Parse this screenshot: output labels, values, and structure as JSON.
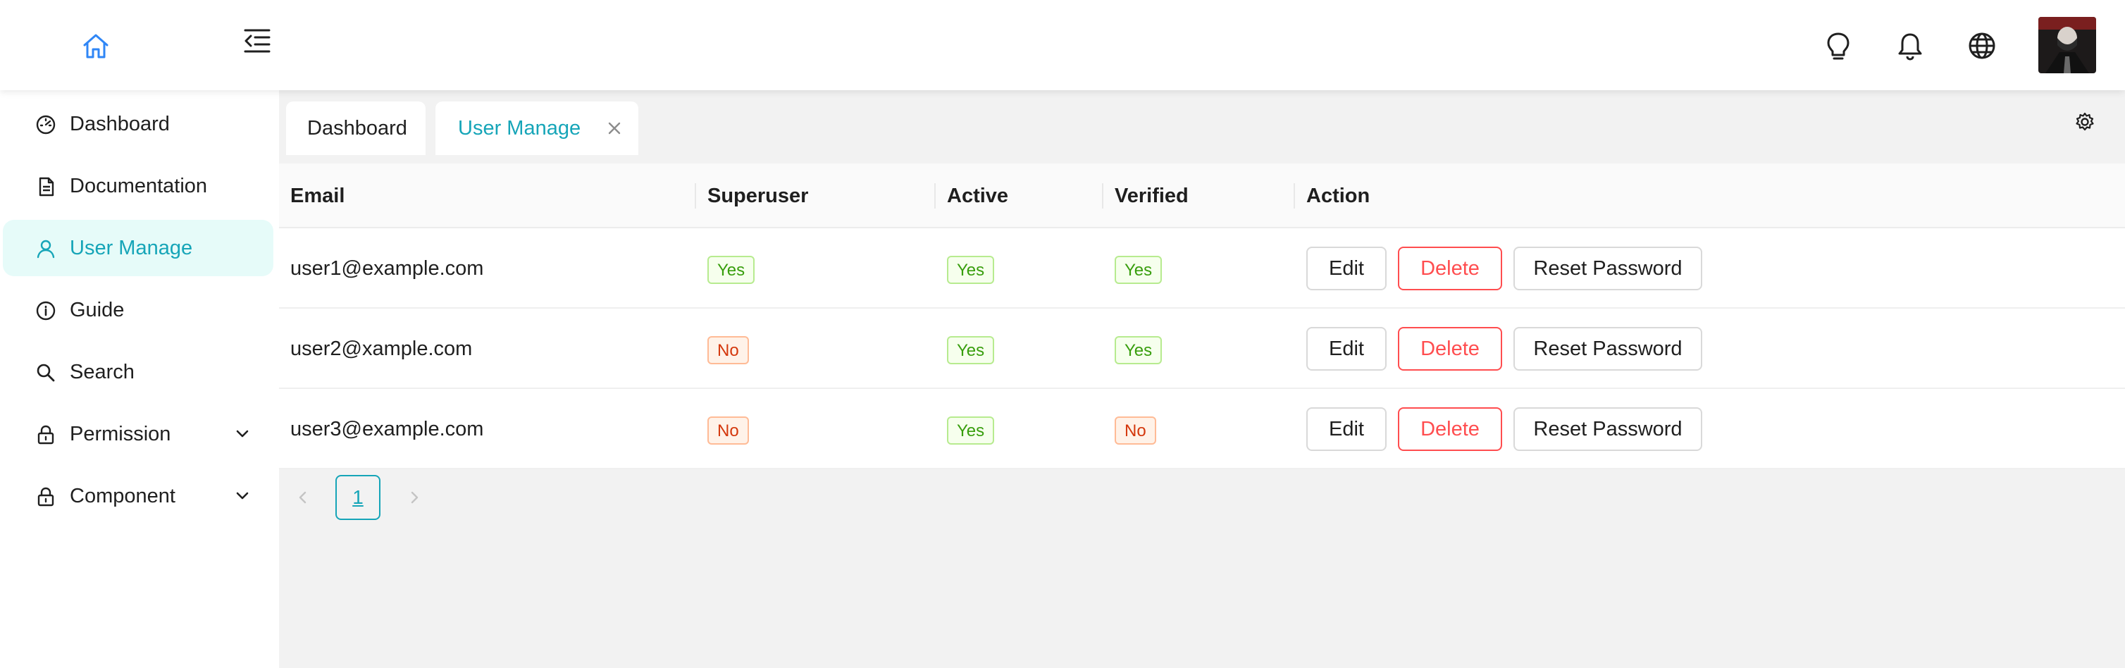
{
  "colors": {
    "accent": "#16a5b8",
    "home_icon": "#2f86f6",
    "danger": "#ff4d4f"
  },
  "header": {
    "home_icon": "home-icon",
    "collapse_icon": "menu-fold-icon",
    "right_icons": [
      "lightbulb-icon",
      "bell-icon",
      "globe-icon"
    ],
    "avatar": "avatar-image"
  },
  "sidebar": {
    "items": [
      {
        "label": "Dashboard",
        "icon": "dashboard-icon"
      },
      {
        "label": "Documentation",
        "icon": "document-icon"
      },
      {
        "label": "User Manage",
        "icon": "user-icon",
        "active": true
      },
      {
        "label": "Guide",
        "icon": "info-icon"
      },
      {
        "label": "Search",
        "icon": "search-icon"
      },
      {
        "label": "Permission",
        "icon": "lock-icon",
        "expandable": true
      },
      {
        "label": "Component",
        "icon": "lock-icon",
        "expandable": true
      }
    ]
  },
  "tabs": [
    {
      "label": "Dashboard"
    },
    {
      "label": "User Manage",
      "active": true,
      "closable": true
    }
  ],
  "table": {
    "headers": {
      "email": "Email",
      "superuser": "Superuser",
      "active": "Active",
      "verified": "Verified",
      "action": "Action"
    },
    "rows": [
      {
        "email": "user1@example.com",
        "superuser": "Yes",
        "active": "Yes",
        "verified": "Yes"
      },
      {
        "email": "user2@xample.com",
        "superuser": "No",
        "active": "Yes",
        "verified": "Yes"
      },
      {
        "email": "user3@example.com",
        "superuser": "No",
        "active": "Yes",
        "verified": "No"
      }
    ],
    "actions": {
      "edit": "Edit",
      "delete": "Delete",
      "reset": "Reset Password"
    }
  },
  "pagination": {
    "current": "1"
  }
}
